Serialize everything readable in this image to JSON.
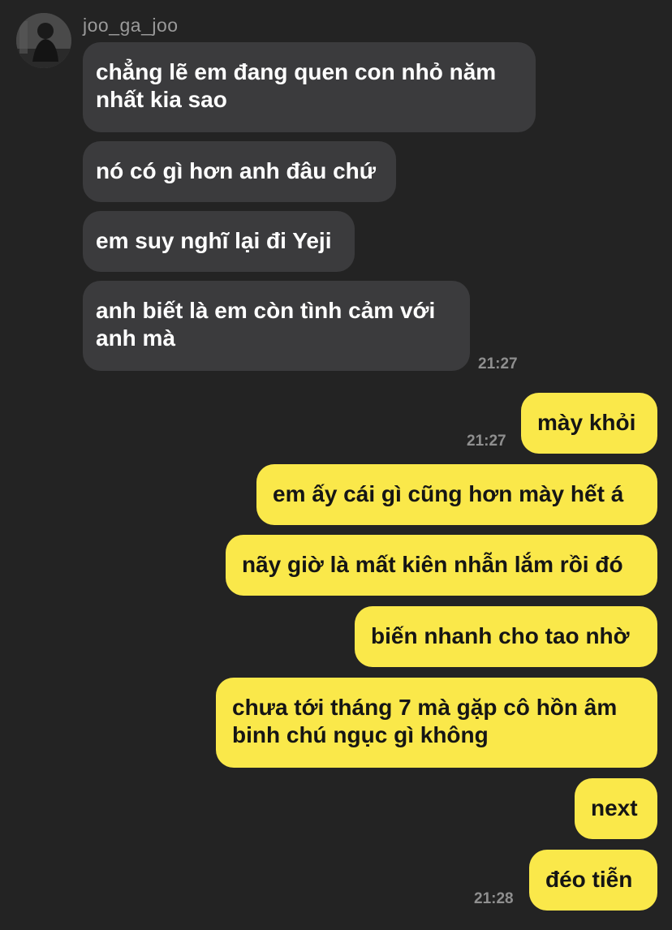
{
  "sender": {
    "name": "joo_ga_joo"
  },
  "incoming": [
    {
      "text": "chẳng lẽ em đang quen con nhỏ năm\nnhất kia sao"
    },
    {
      "text": "nó có gì hơn anh đâu chứ"
    },
    {
      "text": "em suy nghĩ lại đi Yeji"
    },
    {
      "text": "anh biết là em còn tình cảm với\nanh mà"
    }
  ],
  "incoming_time": "21:27",
  "outgoing": [
    {
      "text": "mày khỏi"
    },
    {
      "text": "em ấy cái gì cũng hơn mày hết á"
    },
    {
      "text": "nãy giờ là mất kiên nhẫn lắm rồi đó"
    },
    {
      "text": "biến nhanh cho tao nhờ"
    },
    {
      "text": "chưa tới tháng 7 mà gặp cô hồn âm\nbinh chú ngục gì không"
    },
    {
      "text": "next"
    },
    {
      "text": "đéo tiễn"
    }
  ],
  "outgoing_time_1": "21:27",
  "outgoing_time_2": "21:28",
  "colors": {
    "background": "#232323",
    "incoming_bubble": "#3b3b3d",
    "outgoing_bubble": "#fae84a"
  }
}
